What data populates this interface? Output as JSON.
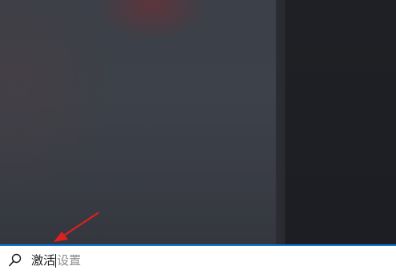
{
  "search": {
    "typed_text": "激活",
    "suggestion_text": "设置",
    "accent_color": "#0a78d7"
  },
  "icons": {
    "search": "search-icon",
    "annotation": "red-arrow-pointer"
  },
  "colors": {
    "annotation_arrow": "#e02020",
    "desktop_left": "#3c4048",
    "desktop_right": "#1c1e23"
  }
}
